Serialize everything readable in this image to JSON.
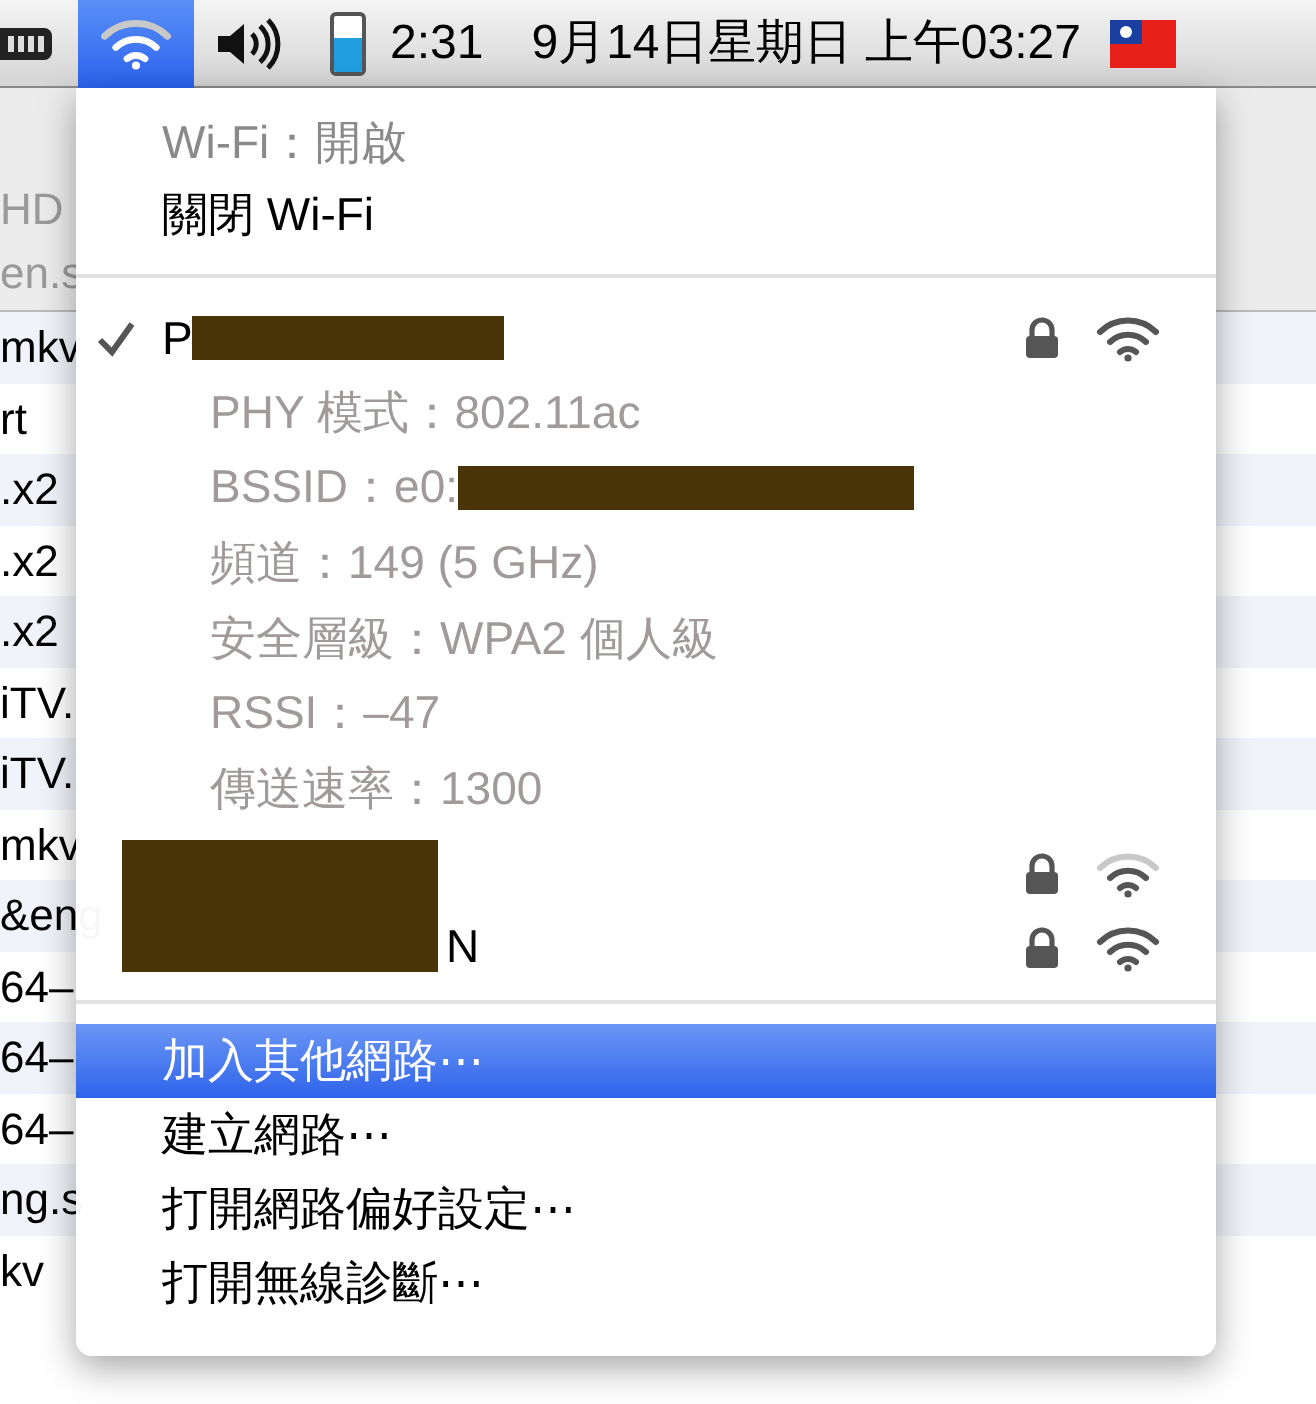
{
  "menu_bar": {
    "wifi_selected": true,
    "battery_time": "2:31",
    "clock": "9月14日星期日 上午03:27"
  },
  "background_list": {
    "header_items": [
      "HD",
      "en.s"
    ],
    "rows": [
      "mkv",
      "rt",
      ".x2",
      ".x2",
      ".x2",
      "iTV.",
      "iTV.",
      "mkv",
      "&eng",
      "64–",
      "64–",
      "64–",
      "ng.s",
      "kv"
    ]
  },
  "wifi_menu": {
    "status": "Wi-Fi：開啟",
    "toggle": "關閉 Wi-Fi",
    "networks": [
      {
        "name": "P",
        "redacted": true,
        "selected": true,
        "locked": true,
        "weak_signal": false,
        "details": [
          {
            "text": "PHY 模式：802.11ac",
            "redacted": false
          },
          {
            "text": "BSSID：e0:",
            "redacted": true
          },
          {
            "text": "頻道：149 (5 GHz)",
            "redacted": false
          },
          {
            "text": "安全層級：WPA2 個人級",
            "redacted": false
          },
          {
            "text": "RSSI：–47",
            "redacted": false
          },
          {
            "text": "傳送速率：1300",
            "redacted": false
          }
        ]
      },
      {
        "redacted": true,
        "selected": false,
        "locked": true,
        "weak_signal": true
      },
      {
        "name": "N",
        "redacted": true,
        "selected": false,
        "locked": true,
        "weak_signal": false
      }
    ],
    "actions": [
      {
        "label": "加入其他網路⋯",
        "selected": true
      },
      {
        "label": "建立網路⋯",
        "selected": false
      },
      {
        "label": "打開網路偏好設定⋯",
        "selected": false
      },
      {
        "label": "打開無線診斷⋯",
        "selected": false
      }
    ]
  }
}
